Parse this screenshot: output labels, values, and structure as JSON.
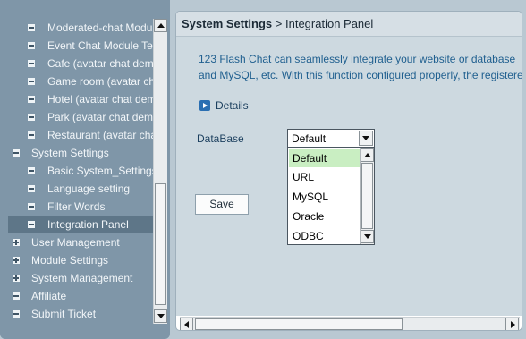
{
  "nav": {
    "items": [
      {
        "label": "Moderated-chat Module",
        "level": "sub",
        "marker": "minus"
      },
      {
        "label": "Event Chat Module Template",
        "level": "sub",
        "marker": "minus"
      },
      {
        "label": "Cafe (avatar chat demo)",
        "level": "sub",
        "marker": "minus"
      },
      {
        "label": "Game room (avatar chat)",
        "level": "sub",
        "marker": "minus"
      },
      {
        "label": "Hotel (avatar chat demo)",
        "level": "sub",
        "marker": "minus"
      },
      {
        "label": "Park (avatar chat demo)",
        "level": "sub",
        "marker": "minus"
      },
      {
        "label": "Restaurant (avatar chat)",
        "level": "sub",
        "marker": "minus"
      },
      {
        "label": "System Settings",
        "level": "top",
        "marker": "minus"
      },
      {
        "label": "Basic System_Settings",
        "level": "sub",
        "marker": "minus"
      },
      {
        "label": "Language setting",
        "level": "sub",
        "marker": "minus"
      },
      {
        "label": "Filter Words",
        "level": "sub",
        "marker": "minus"
      },
      {
        "label": "Integration Panel",
        "level": "sub",
        "marker": "minus",
        "active": true
      },
      {
        "label": "User Management",
        "level": "top",
        "marker": "plus"
      },
      {
        "label": "Module Settings",
        "level": "top",
        "marker": "plus"
      },
      {
        "label": "System Management",
        "level": "top",
        "marker": "plus"
      },
      {
        "label": "Affiliate",
        "level": "top",
        "marker": "minus"
      },
      {
        "label": "Submit Ticket",
        "level": "top",
        "marker": "minus"
      }
    ]
  },
  "header": {
    "section": "System Settings",
    "page": "> Integration Panel"
  },
  "content": {
    "intro_line1": "123 Flash Chat can seamlessly integrate your website or database",
    "intro_line2": "and MySQL, etc. With this function configured properly, the registered",
    "details_label": "Details",
    "database_label": "DataBase",
    "database_value": "Default",
    "database_options": [
      "Default",
      "URL",
      "MySQL",
      "Oracle",
      "ODBC"
    ],
    "save_label": "Save"
  },
  "colors": {
    "nav_bg": "#7f96a8",
    "active_bg": "#5e7688",
    "content_bg": "#cdd9e0",
    "intro_text": "#1f5f8f",
    "selected_option": "#c9eec2"
  }
}
